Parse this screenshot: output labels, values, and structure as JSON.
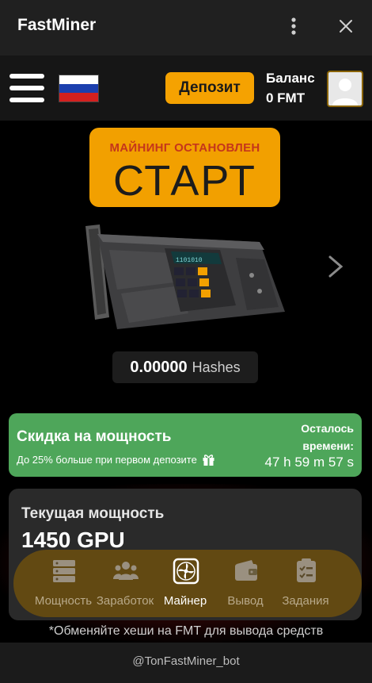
{
  "window": {
    "title": "FastMiner"
  },
  "header": {
    "deposit_label": "Депозит",
    "balance_label": "Баланс",
    "balance_value": "0 FMT",
    "flag": {
      "stripes": [
        "#ffffff",
        "#1c3fae",
        "#d3201f"
      ]
    }
  },
  "miner": {
    "status": "МАЙНИНГ ОСТАНОВЛЕН",
    "start_label": "СТАРТ",
    "chip_text": "1101010",
    "hash_value": "0.00000",
    "hash_unit": "Hashes"
  },
  "promo": {
    "title": "Скидка на мощность",
    "subtitle": "До 25% больше при первом депозите",
    "timer_label": "Осталось времени:",
    "timer_value": "47 h 59 m 57 s"
  },
  "power": {
    "label": "Текущая мощность",
    "value": "1450 GPU"
  },
  "nav": {
    "items": [
      {
        "label": "Мощность",
        "icon": "server-icon"
      },
      {
        "label": "Заработок",
        "icon": "users-icon"
      },
      {
        "label": "Майнер",
        "icon": "fan-icon"
      },
      {
        "label": "Вывод",
        "icon": "wallet-icon"
      },
      {
        "label": "Задания",
        "icon": "checklist-icon"
      }
    ],
    "active": "Майнер"
  },
  "note": "*Обменяйте хеши на FMT для вывода средств",
  "footer": {
    "bot_handle": "@TonFastMiner_bot"
  },
  "colors": {
    "accent": "#f2a000",
    "promo": "#4ea65a",
    "stop_text": "#c5361b"
  }
}
